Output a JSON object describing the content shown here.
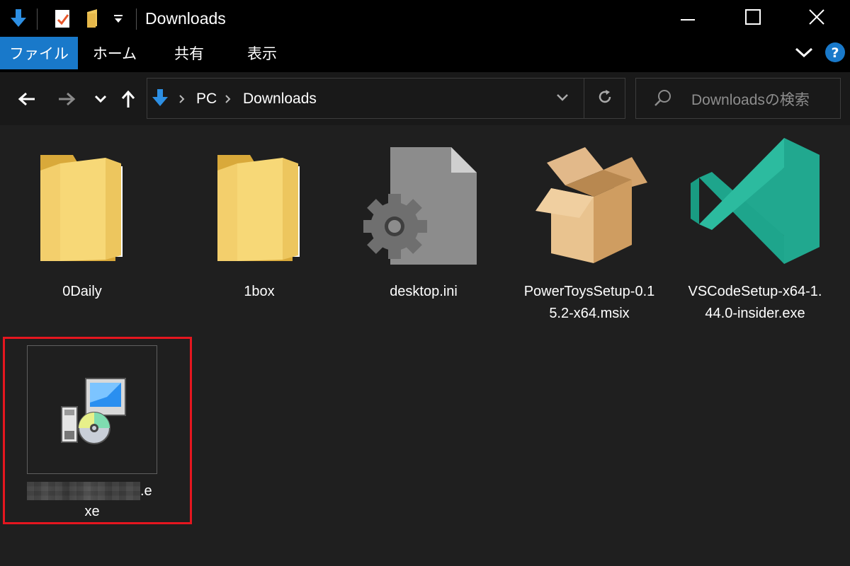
{
  "window": {
    "title": "Downloads",
    "controls": {
      "minimize": "minimize-icon",
      "maximize": "maximize-icon",
      "close": "close-icon"
    }
  },
  "quick_access": [
    "download-arrow-icon",
    "properties-icon",
    "new-folder-icon",
    "customize-dropdown-icon"
  ],
  "ribbon": {
    "tabs": [
      {
        "label": "ファイル",
        "active": true
      },
      {
        "label": "ホーム",
        "active": false
      },
      {
        "label": "共有",
        "active": false
      },
      {
        "label": "表示",
        "active": false
      }
    ],
    "accent": "#1979ca"
  },
  "navigation": {
    "buttons": [
      "back-arrow-icon",
      "forward-arrow-icon",
      "recent-chevron-icon",
      "up-arrow-icon"
    ]
  },
  "address": {
    "crumbs": [
      "PC",
      "Downloads"
    ]
  },
  "search": {
    "placeholder": "Downloadsの検索"
  },
  "files": [
    {
      "name": "0Daily",
      "type": "folder"
    },
    {
      "name": "1box",
      "type": "folder"
    },
    {
      "name": "desktop.ini",
      "type": "settings-file"
    },
    {
      "name": "PowerToysSetup-0.15.2-x64.msix",
      "type": "package"
    },
    {
      "name": "VSCodeSetup-x64-1.44.0-insider.exe",
      "type": "vscode-installer"
    }
  ],
  "selected_file": {
    "name_suffix": ".e",
    "name_line2": "xe",
    "type": "installer-exe",
    "highlight_color": "#e5161f"
  }
}
